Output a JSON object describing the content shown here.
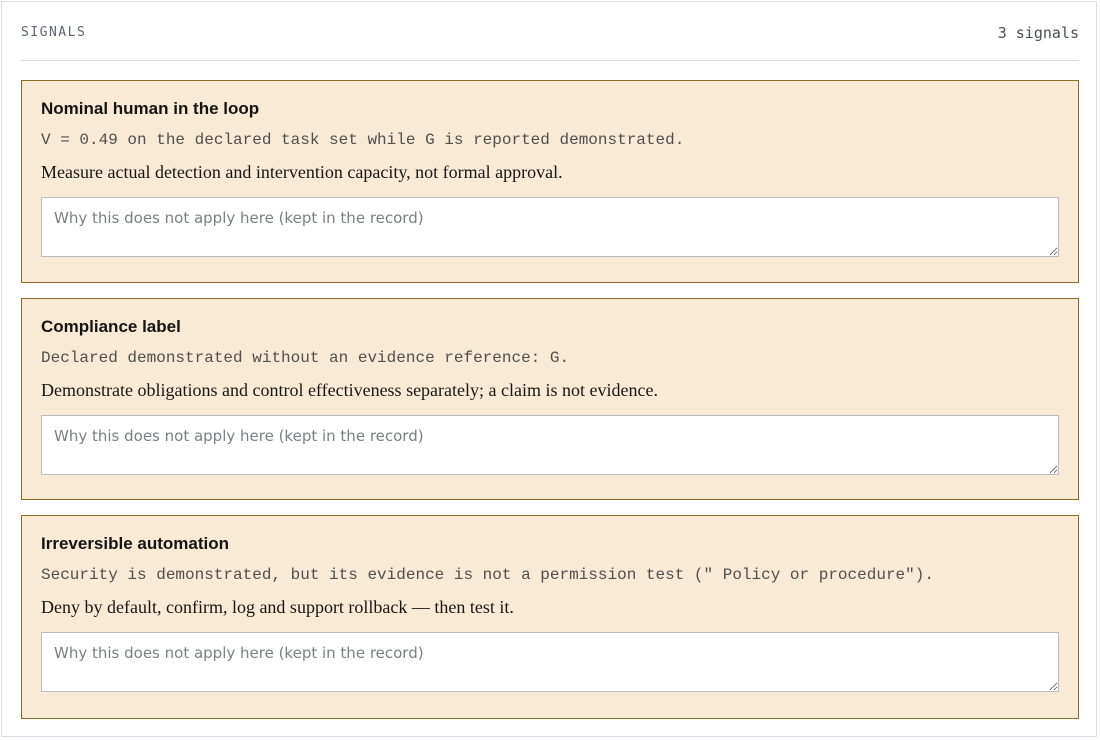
{
  "panel": {
    "title": "SIGNALS",
    "count": "3 signals"
  },
  "signals": [
    {
      "title": "Nominal human in the loop",
      "evidence": "V = 0.49 on the declared task set while G is reported demonstrated.",
      "advice": "Measure actual detection and intervention capacity, not formal approval.",
      "justification_placeholder": "Why this does not apply here (kept in the record)",
      "justification_value": ""
    },
    {
      "title": "Compliance label",
      "evidence": "Declared demonstrated without an evidence reference: G.",
      "advice": "Demonstrate obligations and control effectiveness separately; a claim is not evidence.",
      "justification_placeholder": "Why this does not apply here (kept in the record)",
      "justification_value": ""
    },
    {
      "title": "Irreversible automation",
      "evidence": "Security is demonstrated, but its evidence is not a permission test (\" Policy or procedure\").",
      "advice": "Deny by default, confirm, log and support rollback — then test it.",
      "justification_placeholder": "Why this does not apply here (kept in the record)",
      "justification_value": ""
    }
  ],
  "colors": {
    "card_background": "#f9ead5",
    "card_border": "#8a6a25",
    "muted_text": "#5d6770"
  }
}
